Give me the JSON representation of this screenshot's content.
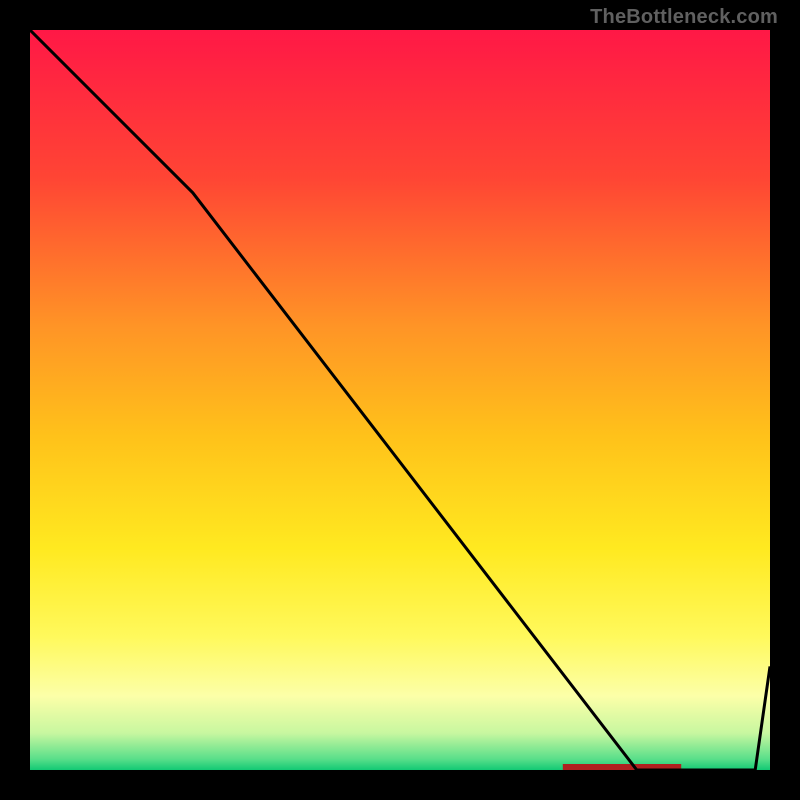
{
  "watermark": "TheBottleneck.com",
  "chart_data": {
    "type": "line",
    "title": "",
    "xlabel": "",
    "ylabel": "",
    "xlim": [
      0,
      100
    ],
    "ylim": [
      0,
      100
    ],
    "series": [
      {
        "name": "curve",
        "x": [
          0,
          22,
          82,
          98,
          100
        ],
        "y": [
          100,
          78,
          0,
          0,
          14
        ]
      }
    ],
    "highlight_range_x": [
      72,
      88
    ],
    "highlight_y": 0,
    "gradient_stops": [
      {
        "offset": 0.0,
        "color": "#ff1846"
      },
      {
        "offset": 0.2,
        "color": "#ff4534"
      },
      {
        "offset": 0.4,
        "color": "#ff9426"
      },
      {
        "offset": 0.55,
        "color": "#ffc21a"
      },
      {
        "offset": 0.7,
        "color": "#ffe920"
      },
      {
        "offset": 0.82,
        "color": "#fff95c"
      },
      {
        "offset": 0.9,
        "color": "#fcffa8"
      },
      {
        "offset": 0.95,
        "color": "#c8f7a0"
      },
      {
        "offset": 0.985,
        "color": "#5adf8a"
      },
      {
        "offset": 1.0,
        "color": "#12c974"
      }
    ]
  }
}
